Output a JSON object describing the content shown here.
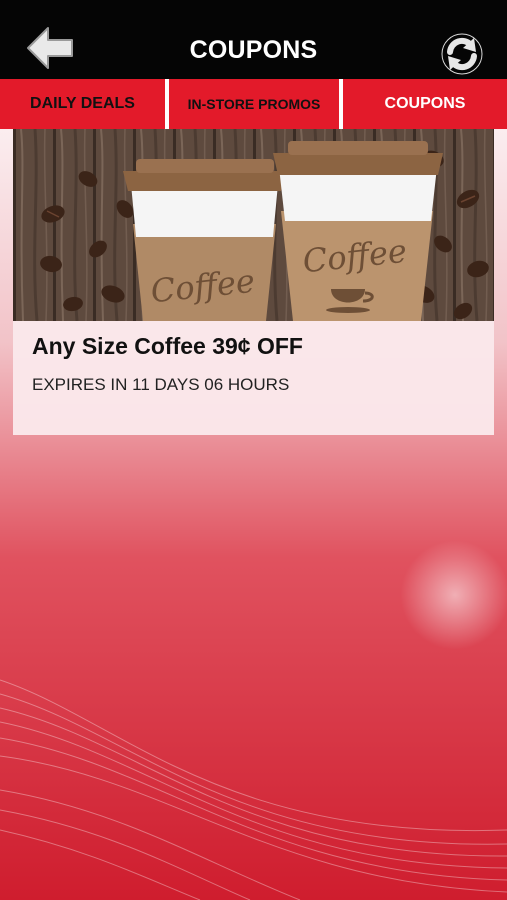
{
  "header": {
    "title": "COUPONS",
    "back_icon": "arrow-left-icon",
    "refresh_icon": "refresh-icon",
    "background_color": "#050505"
  },
  "tabs": [
    {
      "label": "DAILY DEALS",
      "active": false
    },
    {
      "label": "IN-STORE PROMOS",
      "active": false
    },
    {
      "label": "COUPONS",
      "active": true
    }
  ],
  "colors": {
    "accent": "#e31a2a",
    "active_tab_text": "#ffffff",
    "inactive_tab_text": "#111111"
  },
  "coupons": [
    {
      "title": "Any Size Coffee 39¢ OFF",
      "expiry": "EXPIRES IN 11 DAYS 06 HOURS",
      "image_cup_label": "Coffee"
    }
  ]
}
